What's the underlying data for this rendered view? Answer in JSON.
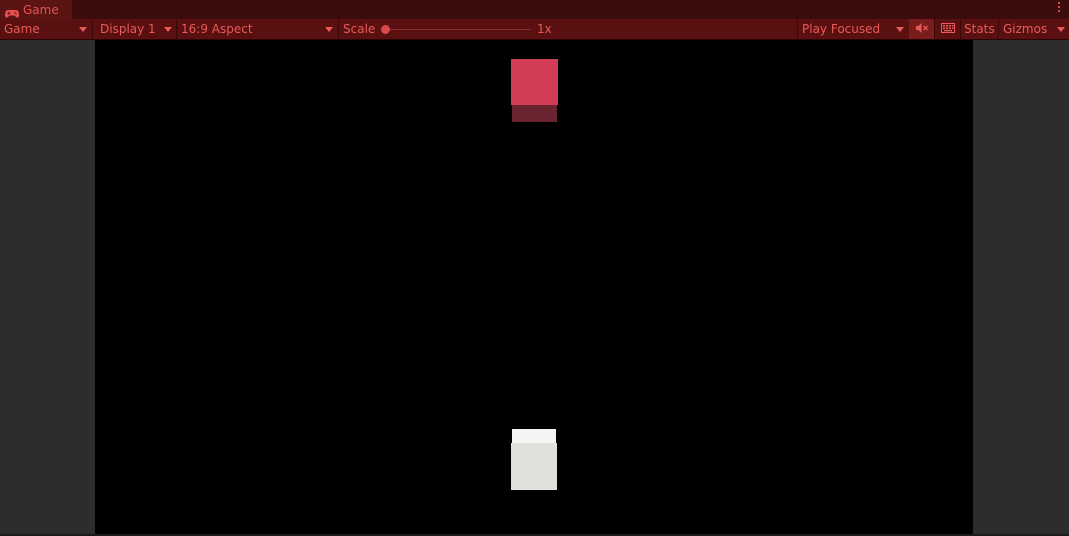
{
  "tab": {
    "title": "Game",
    "icon": "gamepad-icon"
  },
  "toolbar": {
    "view_dropdown": "Game",
    "display_dropdown": "Display 1",
    "aspect_dropdown": "16:9 Aspect",
    "scale_label": "Scale",
    "scale_value": "1x",
    "scale_fraction": 0.0,
    "play_mode_dropdown": "Play Focused",
    "mute_icon": "mute-audio-icon",
    "keyboard_icon": "keyboard-shortcuts-icon",
    "stats_label": "Stats",
    "gizmos_label": "Gizmos"
  },
  "colors": {
    "accent": "#e85a5a",
    "toolbar_bg": "#5a1010",
    "tabbar_bg": "#3a0c0c",
    "red_cube": "#d33c55",
    "white_cube": "#e0e0dd",
    "viewport_bg": "#000000"
  }
}
